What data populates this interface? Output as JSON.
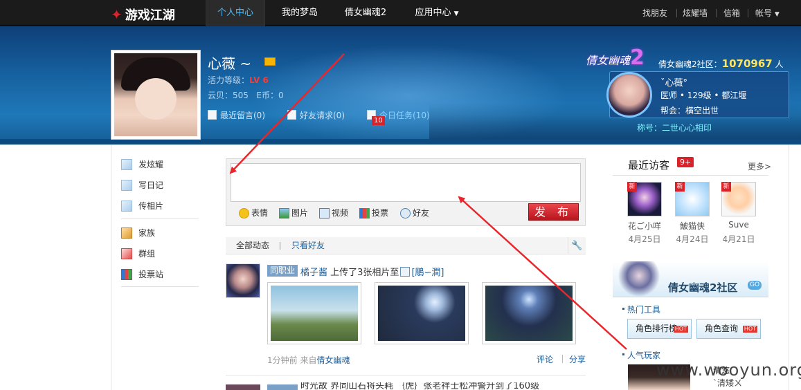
{
  "topnav": {
    "logo": "游戏江湖",
    "items": [
      "个人中心",
      "我的梦岛",
      "倩女幽魂2",
      "应用中心"
    ],
    "right": [
      "找朋友",
      "炫耀墙",
      "信箱",
      "帐号"
    ]
  },
  "profile": {
    "name": "心薇 ~",
    "level_label": "活力等级：",
    "level": "LV 6",
    "coins": "云贝：505",
    "ecoin": "E币：0",
    "links": [
      "最近留言(0)",
      "好友请求(0)",
      "今日任务(10)"
    ],
    "task_badge": "10"
  },
  "game": {
    "logo_text": "倩女幽魂",
    "logo_num": "2",
    "community_label": "倩女幽魂2社区：",
    "community_count": "1070967",
    "community_unit": "人",
    "char_name": "ˇ心薇°",
    "char_info": "医师 • 129级 • 都江堰",
    "char_gang": "帮会：横空出世",
    "char_title": "称号：二世心心相印"
  },
  "sidebar": [
    "发炫耀",
    "写日记",
    "传相片",
    "家族",
    "群组",
    "投票站"
  ],
  "composer": {
    "tools": [
      "表情",
      "图片",
      "视频",
      "投票",
      "好友"
    ],
    "publish": "发 布"
  },
  "feed": {
    "tabs": [
      "全部动态",
      "只看好友"
    ],
    "item": {
      "tag": "同职业",
      "user": "橘子酱",
      "action": "上传了3张相片至",
      "album": "[鵰∽澗]",
      "time": "1分钟前 来自",
      "source": "倩女幽魂",
      "comment": "评论",
      "share": "分享"
    },
    "item2_text": "时光故 界同山石将头耗 ｛虎｝张老祥士松冲警升到了160级"
  },
  "visitors": {
    "title": "最近访客",
    "badge": "9+",
    "more": "更多>",
    "new": "新",
    "list": [
      {
        "name": "花ご小咩",
        "date": "4月25日"
      },
      {
        "name": "鮍猫侠",
        "date": "4月24日"
      },
      {
        "name": "Suve",
        "date": "4月21日"
      }
    ]
  },
  "community": {
    "title": "倩女幽魂2社区",
    "go": "GO",
    "hot_tools": "热门工具",
    "btn1": "角色排行榜",
    "btn2": "角色查询",
    "hot": "HOT",
    "popular": "人气玩家",
    "player": "清悠",
    "player_sub": "`清矮ㄨ"
  },
  "watermark": "www.wooyun.org"
}
